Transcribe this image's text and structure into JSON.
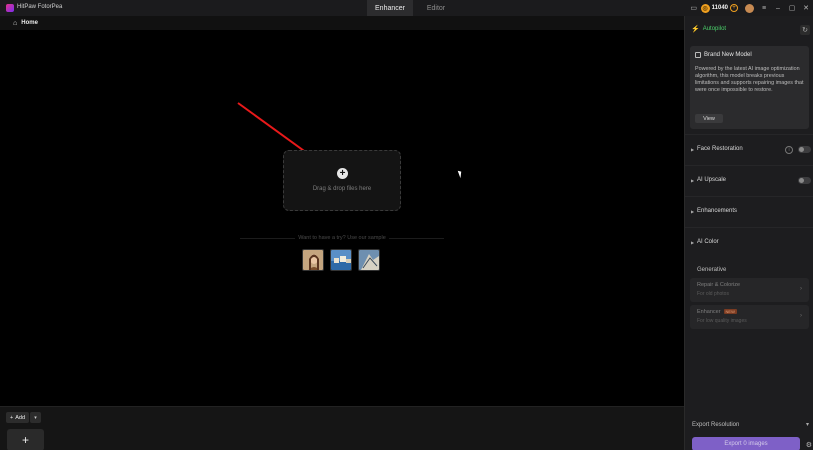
{
  "app": {
    "title": "HitPaw FotorPea"
  },
  "tabs": [
    {
      "label": "Enhancer",
      "active": true
    },
    {
      "label": "Editor",
      "active": false
    }
  ],
  "titlebar": {
    "credits": "11040"
  },
  "breadcrumb": {
    "home": "Home"
  },
  "dropzone": {
    "text": "Drag & drop files here"
  },
  "samples": {
    "prompt": "Want to have a try? Use our sample"
  },
  "bottom": {
    "add_label": "Add"
  },
  "panel": {
    "autopilot": "Autopilot",
    "model_card": {
      "title": "Brand New Model",
      "description": "Powered by the latest AI image optimization algorithm, this model breaks previous limitations and supports repairing images that were once impossible to restore.",
      "view": "View"
    },
    "sections": [
      {
        "label": "Face Restoration"
      },
      {
        "label": "AI Upscale"
      },
      {
        "label": "Enhancements"
      },
      {
        "label": "AI Color"
      }
    ],
    "generative": {
      "title": "Generative",
      "cards": [
        {
          "title": "Repair & Colorize",
          "subtitle": "For old photos"
        },
        {
          "title": "Enhancer",
          "badge": "NEW",
          "subtitle": "For low quality images"
        }
      ]
    },
    "export_resolution": "Export Resolution",
    "export_button": "Export 0 images"
  },
  "colors": {
    "accent": "#7e60c7",
    "autopilot": "#4bd06b",
    "annotation_arrow": "#e8191a"
  }
}
